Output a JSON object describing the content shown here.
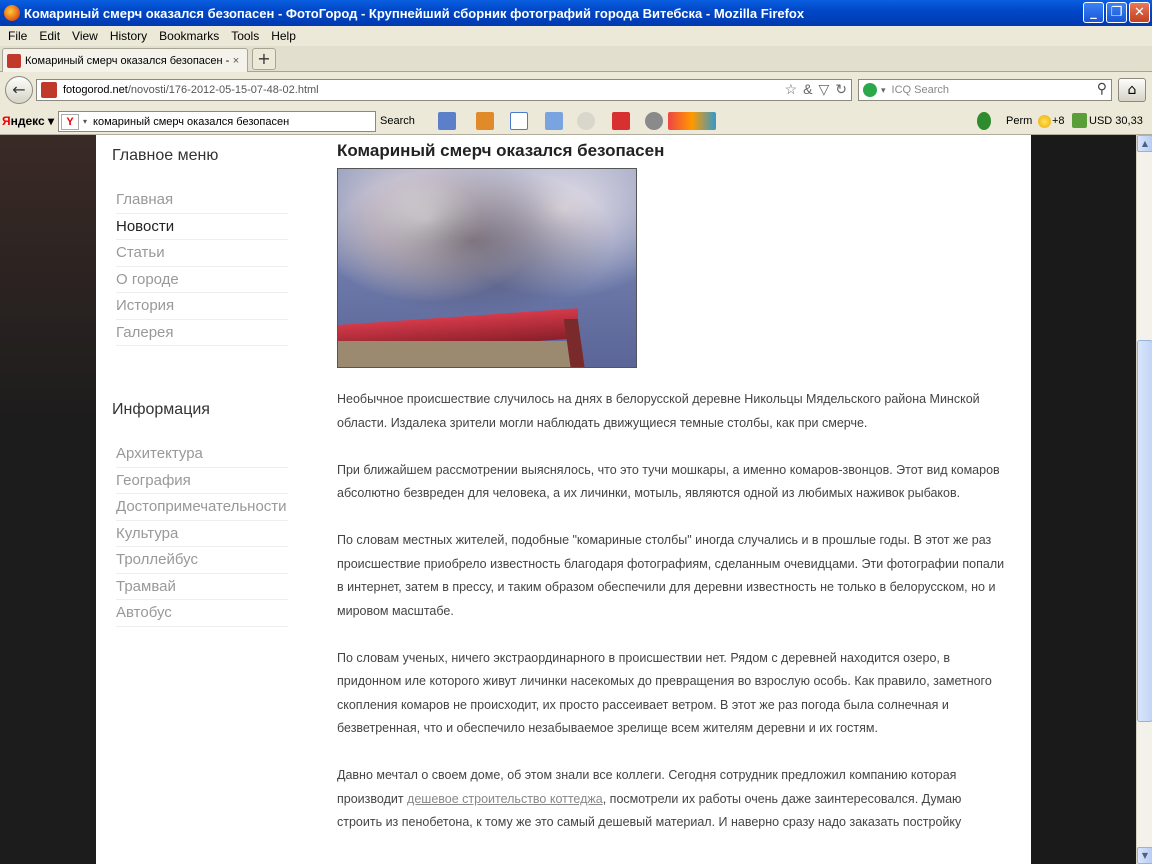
{
  "window": {
    "title": "Комариный смерч оказался безопасен - ФотоГород - Крупнейший сборник фотографий города Витебска - Mozilla Firefox",
    "minimize": "_",
    "maximize": "❐",
    "close": "✕"
  },
  "menu": [
    "File",
    "Edit",
    "View",
    "History",
    "Bookmarks",
    "Tools",
    "Help"
  ],
  "tab": {
    "title": "Комариный смерч оказался безопасен - Ф...",
    "close": "×",
    "new_tab": "+"
  },
  "nav": {
    "back": "←",
    "url_domain": "fotogorod.net",
    "url_path": "/novosti/176-2012-05-15-07-48-02.html",
    "url_icons": [
      "☆",
      "&",
      "▽",
      "↻"
    ],
    "search_placeholder": "ICQ Search",
    "search_icon": "⚲",
    "home": "⌂"
  },
  "yandex": {
    "logo_first": "Я",
    "logo_rest": "ндекс",
    "caret": "▾",
    "badge": "Y",
    "query": "комариный смерч оказался безопасен",
    "search_label": "Search",
    "city": "Perm",
    "temperature": "+8",
    "currency": "USD 30,33"
  },
  "sidebar": {
    "menu_title": "Главное меню",
    "menu_items": [
      "Главная",
      "Новости",
      "Статьи",
      "О городе",
      "История",
      "Галерея"
    ],
    "active_index": 1,
    "info_title": "Информация",
    "info_items": [
      "Архитектура",
      "География",
      "Достопримечательности",
      "Культура",
      "Троллейбус",
      "Трамвай",
      "Автобус"
    ]
  },
  "article": {
    "title": "Комариный смерч оказался безопасен",
    "paragraphs": [
      "Необычное происшествие случилось на днях в белорусской деревне Никольцы Мядельского района Минской области. Издалека зрители могли наблюдать движущиеся темные столбы, как при смерче.",
      "При ближайшем рассмотрении выяснялось, что это тучи мошкары, а именно комаров-звонцов. Этот вид комаров абсолютно безвреден для человека, а их личинки, мотыль, являются одной из любимых наживок рыбаков.",
      "По словам местных жителей, подобные \"комариные столбы\" иногда случались и в прошлые годы. В этот же раз происшествие приобрело известность благодаря фотографиям, сделанным очевидцами. Эти фотографии попали в интернет, затем в прессу, и таким образом обеспечили для деревни известность не только в белорусском, но и мировом масштабе.",
      "По словам ученых, ничего экстраординарного в происшествии нет. Рядом с деревней находится озеро, в придонном иле которого живут личинки насекомых до превращения во взрослую особь. Как правило, заметного скопления комаров не происходит, их просто рассеивает ветром. В этот же раз погода была солнечная и безветренная, что и обеспечило незабываемое зрелище всем жителям деревни и их гостям."
    ],
    "last_before": "Давно мечтал о своем доме, об этом знали все коллеги. Сегодня сотрудник предложил компанию которая производит ",
    "last_link": "дешевое строительство коттеджа",
    "last_after": ", посмотрели их работы очень даже заинтересовался. Думаю строить из пенобетона, к тому же это самый дешевый материал. И наверно сразу надо заказать постройку"
  },
  "scrollbar": {
    "up": "▲",
    "down": "▼",
    "thumb_top_fraction": 0.27,
    "thumb_size_fraction": 0.55
  }
}
